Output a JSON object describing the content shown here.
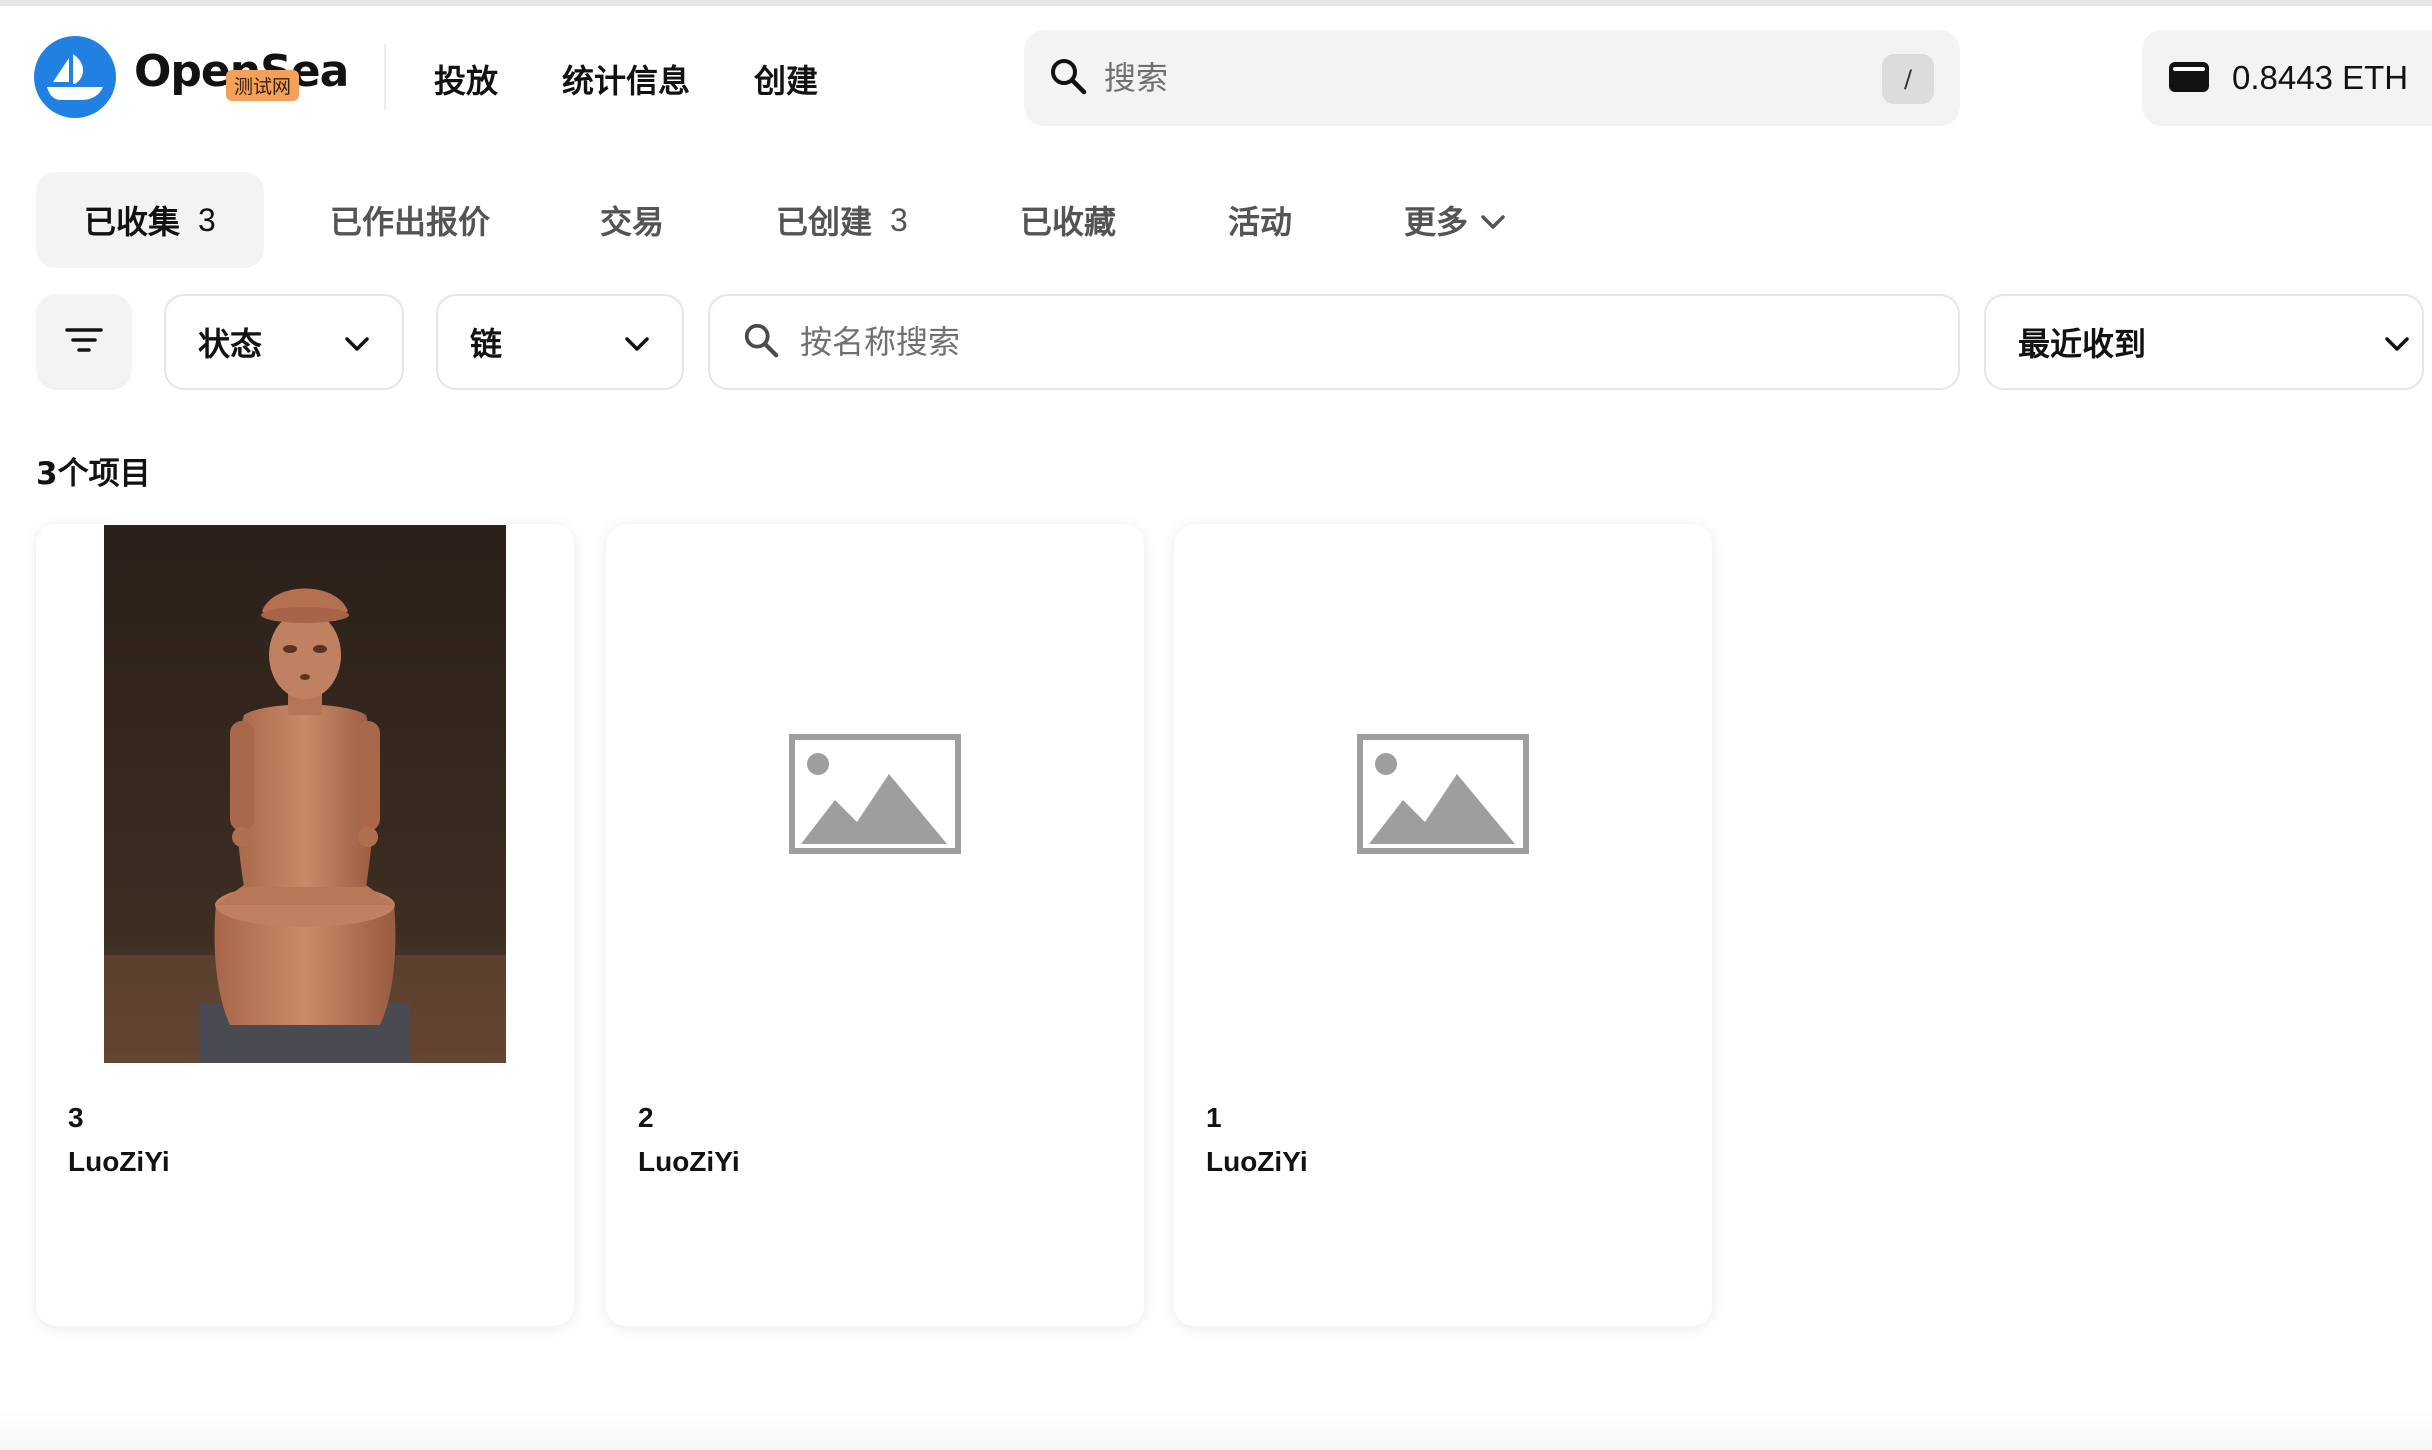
{
  "header": {
    "brand": "OpenSea",
    "network_badge": "测试网",
    "nav": [
      "投放",
      "统计信息",
      "创建"
    ],
    "search_placeholder": "搜索",
    "search_shortcut": "/",
    "wallet_balance": "0.8443 ETH"
  },
  "tabs": [
    {
      "label": "已收集",
      "count": "3",
      "active": true
    },
    {
      "label": "已作出报价"
    },
    {
      "label": "交易"
    },
    {
      "label": "已创建",
      "count": "3"
    },
    {
      "label": "已收藏"
    },
    {
      "label": "活动"
    },
    {
      "label": "更多"
    }
  ],
  "filters": {
    "status_label": "状态",
    "chain_label": "链",
    "name_search_placeholder": "按名称搜索",
    "sort_label": "最近收到"
  },
  "results": {
    "count_text": "3个项目"
  },
  "items": [
    {
      "number": "3",
      "collection": "LuoZiYi",
      "media": "photo-statue"
    },
    {
      "number": "2",
      "collection": "LuoZiYi",
      "media": "image-placeholder-icon"
    },
    {
      "number": "1",
      "collection": "LuoZiYi",
      "media": "image-placeholder-icon"
    }
  ],
  "colors": {
    "brand_blue": "#2081e2",
    "badge_orange": "#f2a05a",
    "surface_gray": "#f3f3f3",
    "placeholder_gray": "#9e9e9e"
  }
}
